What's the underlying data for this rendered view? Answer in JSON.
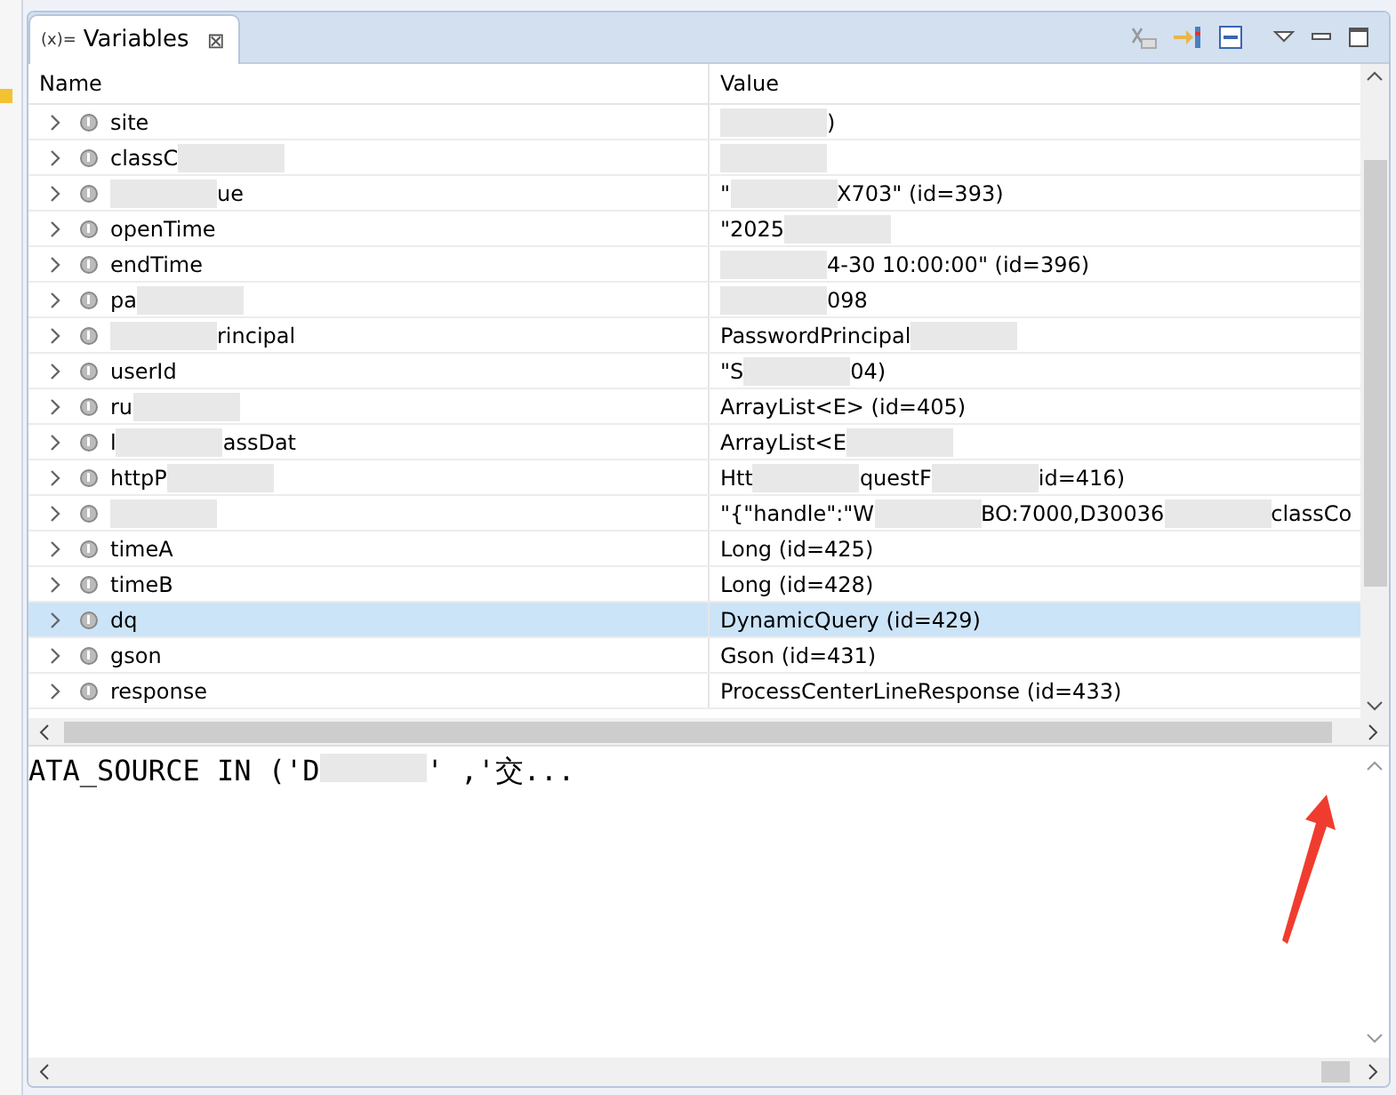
{
  "view_tab": {
    "icon_text": "(x)=",
    "title": "Variables",
    "close": "⊠",
    "selected": true
  },
  "table": {
    "columns": [
      "Name",
      "Value"
    ],
    "rows": [
      {
        "selected": false,
        "name": [
          {
            "kind": "text",
            "text": "site"
          }
        ],
        "value": [
          {
            "kind": "blur"
          },
          {
            "kind": "text",
            "text": ")"
          }
        ]
      },
      {
        "selected": false,
        "name": [
          {
            "kind": "text",
            "text": "classC"
          },
          {
            "kind": "blur"
          }
        ],
        "value": [
          {
            "kind": "blur"
          }
        ]
      },
      {
        "selected": false,
        "name": [
          {
            "kind": "blur"
          },
          {
            "kind": "text",
            "text": "ue"
          }
        ],
        "value": [
          {
            "kind": "text",
            "text": "\""
          },
          {
            "kind": "blur"
          },
          {
            "kind": "text",
            "text": "X703\" (id=393)"
          }
        ]
      },
      {
        "selected": false,
        "name": [
          {
            "kind": "text",
            "text": "openTime"
          }
        ],
        "value": [
          {
            "kind": "text",
            "text": "\"2025"
          },
          {
            "kind": "blur"
          }
        ]
      },
      {
        "selected": false,
        "name": [
          {
            "kind": "text",
            "text": "endTime"
          }
        ],
        "value": [
          {
            "kind": "blur"
          },
          {
            "kind": "text",
            "text": "4-30 10:00:00\" (id=396)"
          }
        ]
      },
      {
        "selected": false,
        "name": [
          {
            "kind": "text",
            "text": "pa"
          },
          {
            "kind": "blur"
          }
        ],
        "value": [
          {
            "kind": "blur"
          },
          {
            "kind": "text",
            "text": "098"
          }
        ]
      },
      {
        "selected": false,
        "name": [
          {
            "kind": "blur"
          },
          {
            "kind": "text",
            "text": "rincipal"
          }
        ],
        "value": [
          {
            "kind": "text",
            "text": "PasswordPrincipal"
          },
          {
            "kind": "blur"
          }
        ]
      },
      {
        "selected": false,
        "name": [
          {
            "kind": "text",
            "text": "userId"
          }
        ],
        "value": [
          {
            "kind": "text",
            "text": "\"S"
          },
          {
            "kind": "blur"
          },
          {
            "kind": "text",
            "text": "04)"
          }
        ]
      },
      {
        "selected": false,
        "name": [
          {
            "kind": "text",
            "text": "ru"
          },
          {
            "kind": "blur"
          }
        ],
        "value": [
          {
            "kind": "text",
            "text": "ArrayList<E>  (id=405)"
          }
        ]
      },
      {
        "selected": false,
        "name": [
          {
            "kind": "text",
            "text": "l"
          },
          {
            "kind": "blur"
          },
          {
            "kind": "text",
            "text": "assDat"
          }
        ],
        "value": [
          {
            "kind": "text",
            "text": "ArrayList<E"
          },
          {
            "kind": "blur"
          }
        ]
      },
      {
        "selected": false,
        "name": [
          {
            "kind": "text",
            "text": "httpP"
          },
          {
            "kind": "blur"
          }
        ],
        "value": [
          {
            "kind": "text",
            "text": "Htt"
          },
          {
            "kind": "blur"
          },
          {
            "kind": "text",
            "text": "questF"
          },
          {
            "kind": "blur"
          },
          {
            "kind": "text",
            "text": "id=416)"
          }
        ]
      },
      {
        "selected": false,
        "name": [
          {
            "kind": "blur"
          }
        ],
        "value": [
          {
            "kind": "text",
            "text": "\"{\"handle\":\"W"
          },
          {
            "kind": "blur"
          },
          {
            "kind": "text",
            "text": "BO:7000,D30036"
          },
          {
            "kind": "blur"
          },
          {
            "kind": "text",
            "text": "classCo"
          }
        ]
      },
      {
        "selected": false,
        "name": [
          {
            "kind": "text",
            "text": "timeA"
          }
        ],
        "value": [
          {
            "kind": "text",
            "text": "Long  (id=425)"
          }
        ]
      },
      {
        "selected": false,
        "name": [
          {
            "kind": "text",
            "text": "timeB"
          }
        ],
        "value": [
          {
            "kind": "text",
            "text": "Long  (id=428)"
          }
        ]
      },
      {
        "selected": true,
        "name": [
          {
            "kind": "text",
            "text": "dq"
          }
        ],
        "value": [
          {
            "kind": "text",
            "text": "DynamicQuery  (id=429)"
          }
        ]
      },
      {
        "selected": false,
        "name": [
          {
            "kind": "text",
            "text": "gson"
          }
        ],
        "value": [
          {
            "kind": "text",
            "text": "Gson  (id=431)"
          }
        ]
      },
      {
        "selected": false,
        "name": [
          {
            "kind": "text",
            "text": "response"
          }
        ],
        "value": [
          {
            "kind": "text",
            "text": "ProcessCenterLineResponse  (id=433)"
          }
        ]
      }
    ]
  },
  "detail": [
    {
      "kind": "text",
      "text": "ATA_SOURCE IN ('D"
    },
    {
      "kind": "blur"
    },
    {
      "kind": "text",
      "text": "' ,'交..."
    }
  ]
}
